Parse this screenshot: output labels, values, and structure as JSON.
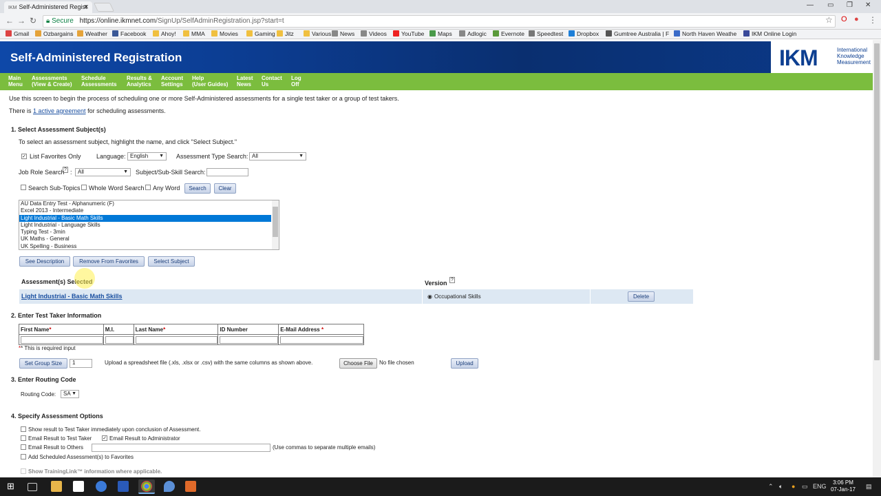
{
  "browser": {
    "tab_title": "Self-Administered Regist",
    "tab_favicon": "IKM",
    "secure_label": "Secure",
    "url_main": "https://online.ikmnet.com",
    "url_path": "/SignUp/SelfAdminRegistration.jsp?start=t",
    "bookmarks": [
      "Gmail",
      "Ozbargains",
      "Weather",
      "Facebook",
      "Ahoy!",
      "MMA",
      "Movies",
      "Gaming",
      "Jitz",
      "Various",
      "News",
      "Videos",
      "YouTube",
      "Maps",
      "Adlogic",
      "Evernote",
      "Speedtest",
      "Dropbox",
      "Gumtree Australia | F",
      "North Haven Weathe",
      "IKM Online Login"
    ]
  },
  "banner": {
    "title": "Self-Administered Registration"
  },
  "logo": {
    "mark": "IKM",
    "line1": "International",
    "line2": "Knowledge",
    "line3": "Measurement"
  },
  "menu": [
    {
      "l1": "Main",
      "l2": "Menu"
    },
    {
      "l1": "Assessments",
      "l2": "(View & Create)"
    },
    {
      "l1": "Schedule",
      "l2": "Assessments"
    },
    {
      "l1": "Results &",
      "l2": "Analytics"
    },
    {
      "l1": "Account",
      "l2": "Settings"
    },
    {
      "l1": "Help",
      "l2": "(User Guides)"
    },
    {
      "l1": "Latest",
      "l2": "News"
    },
    {
      "l1": "Contact",
      "l2": "Us"
    },
    {
      "l1": "Log",
      "l2": "Off"
    }
  ],
  "intro": {
    "line1": "Use this screen to begin the process of scheduling one or more Self-Administered assessments for a single test taker or a group of test takers.",
    "agreement_pre": "There is ",
    "agreement_link": "1 active agreement",
    "agreement_post": " for scheduling assessments."
  },
  "section1": {
    "heading": "1. Select Assessment Subject(s)",
    "instructions": "To select an assessment subject, highlight the name, and click \"Select Subject.\"",
    "list_favorites_label": "List Favorites Only",
    "list_favorites_checked": true,
    "language_label": "Language:",
    "language_value": "English",
    "type_search_label": "Assessment Type Search:",
    "type_search_value": "All",
    "job_role_label": "Job Role Search",
    "job_role_value": "All",
    "subject_search_label": "Subject/Sub-Skill Search:",
    "subject_search_value": "",
    "search_subtopics_label": "Search Sub-Topics",
    "whole_word_label": "Whole Word Search",
    "any_word_label": "Any Word",
    "search_btn": "Search",
    "clear_btn": "Clear",
    "subjects": [
      "AU Data Entry Test - Alphanumeric (F)",
      "Excel 2013 - Intermediate",
      "Light Industrial - Basic Math Skills",
      "Light Industrial - Language Skills",
      "Typing Test - 3min",
      "UK Maths - General",
      "UK Spelling - Business"
    ],
    "selected_index": 2,
    "see_description_btn": "See Description",
    "remove_favorites_btn": "Remove From Favorites",
    "select_subject_btn": "Select Subject",
    "selected_header": "Assessment(s) Selected",
    "version_header": "Version",
    "selected_assessment": "Light Industrial - Basic Math Skills",
    "selected_version": "Occupational Skills",
    "delete_btn": "Delete"
  },
  "section2": {
    "heading": "2. Enter Test Taker Information",
    "cols": [
      "First Name",
      "M.I.",
      "Last Name",
      "ID Number",
      "E-Mail Address"
    ],
    "required_note": "* This is required input",
    "set_group_btn": "Set Group Size",
    "group_size": "1",
    "upload_text": "Upload a spreadsheet file (.xls, .xlsx or .csv) with the same columns as shown above.",
    "choose_file_btn": "Choose File",
    "no_file": "No file chosen",
    "upload_btn": "Upload"
  },
  "section3": {
    "heading": "3. Enter Routing Code",
    "routing_label": "Routing Code:",
    "routing_value": "SA"
  },
  "section4": {
    "heading": "4. Specify Assessment Options",
    "opt_show_result": "Show result to Test Taker immediately upon conclusion of Assessment.",
    "opt_email_taker": "Email Result to Test Taker",
    "opt_email_admin": "Email Result to Administrator",
    "opt_email_others": "Email Result to Others",
    "email_others_hint": "(Use commas to separate multiple emails)",
    "opt_add_fav": "Add Scheduled Assessment(s) to Favorites",
    "opt_traininglink": "Show TrainingLink™ information where applicable."
  },
  "taskbar": {
    "time": "3:06 PM",
    "date": "07-Jan-17",
    "lang": "ENG"
  },
  "colors": {
    "banner": "#0b3a8a",
    "menu": "#7bbd3e",
    "selection": "#0078d7",
    "link": "#1a4fa0"
  }
}
